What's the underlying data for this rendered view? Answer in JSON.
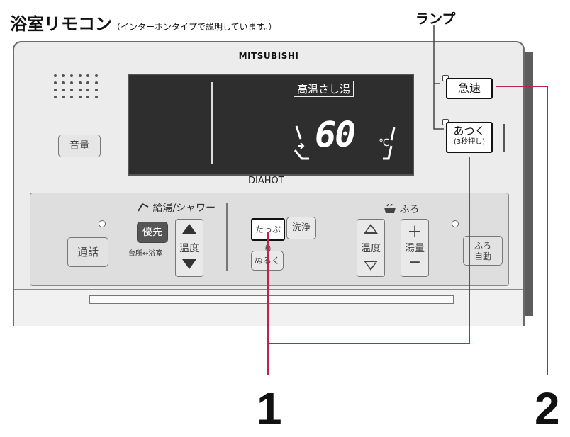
{
  "title": {
    "main": "浴室リモコン",
    "note": "（インターホンタイプで説明しています。）"
  },
  "lamp_label": "ランプ",
  "remote": {
    "brand": "MITSUBISHI",
    "model": "DIAHOT",
    "volume_button": "音量",
    "display": {
      "mode_label": "高温さし湯",
      "temperature": "60",
      "unit": "℃"
    },
    "kyusoku_button": "急速",
    "atsuku_button": {
      "line1": "あつく",
      "line2": "(3秒押し)"
    },
    "shower_section": {
      "header": "給湯/シャワー",
      "call_button": "通話",
      "priority_button": "優先",
      "priority_sublabel": "台所↔浴室",
      "temp_label": "温度"
    },
    "center": {
      "tappuri_button": "たっぷり",
      "nuruku_button": "ぬるく",
      "wash_button": "洗浄"
    },
    "bath_section": {
      "header": "ふろ",
      "temp_label": "温度",
      "amount_label": "湯量",
      "plus": "＋",
      "minus": "−",
      "auto_button_line1": "ふろ",
      "auto_button_line2": "自動"
    }
  },
  "callouts": {
    "one": "1",
    "two": "2"
  },
  "colors": {
    "callout_line": "#c0224a",
    "callout_line_gray": "#444444",
    "display_bg": "#2e2e2e"
  }
}
